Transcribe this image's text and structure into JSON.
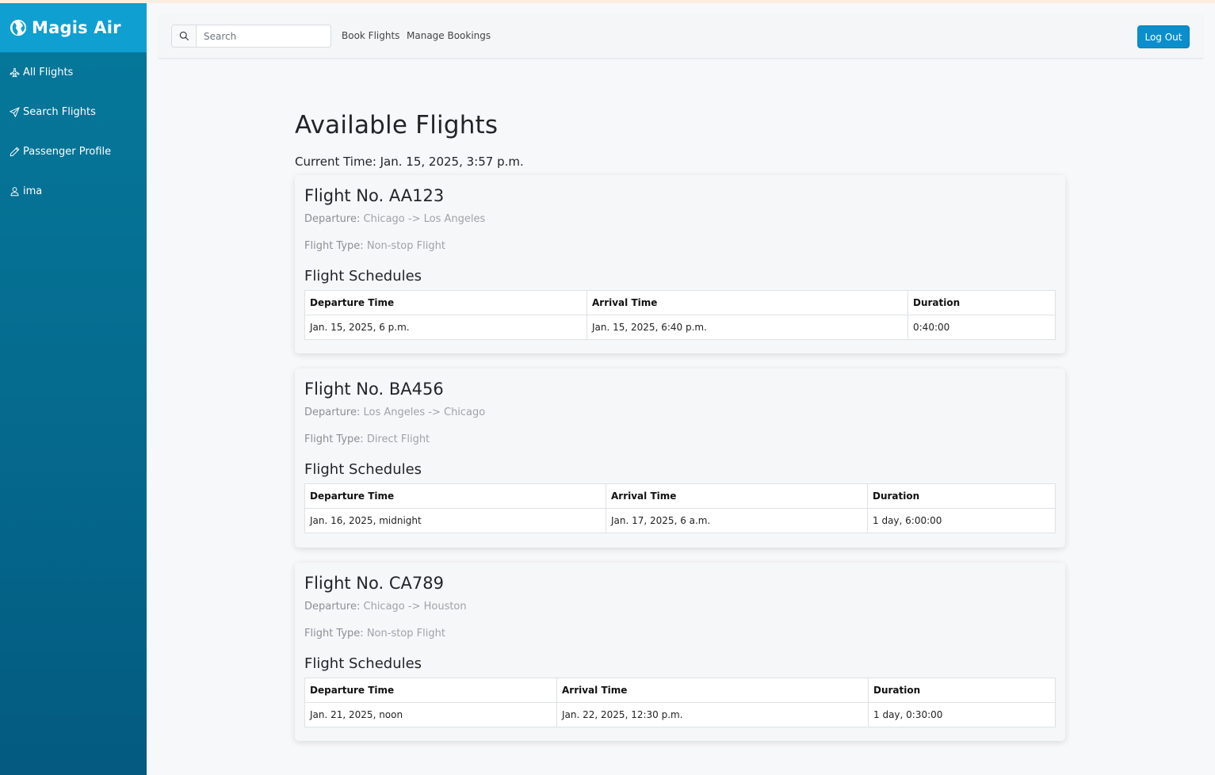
{
  "app": {
    "name": "Magis Air"
  },
  "sidebar": {
    "items": [
      {
        "label": "All Flights",
        "icon": "plane-icon"
      },
      {
        "label": "Search Flights",
        "icon": "send-icon"
      },
      {
        "label": "Passenger Profile",
        "icon": "pencil-icon"
      },
      {
        "label": "ima",
        "icon": "user-icon"
      }
    ]
  },
  "topbar": {
    "search_placeholder": "Search",
    "links": [
      "Book Flights",
      "Manage Bookings"
    ],
    "logout_label": "Log Out"
  },
  "main": {
    "heading": "Available Flights",
    "current_time": "Current Time: Jan. 15, 2025, 3:57 p.m.",
    "flights": [
      {
        "title": "Flight No. AA123",
        "departure_label": "Departure:",
        "departure_value": "Chicago -> Los Angeles",
        "type_label": "Flight Type:",
        "type_value": "Non-stop Flight",
        "schedules_title": "Flight Schedules",
        "columns": [
          "Departure Time",
          "Arrival Time",
          "Duration"
        ],
        "rows": [
          [
            "Jan. 15, 2025, 6 p.m.",
            "Jan. 15, 2025, 6:40 p.m.",
            "0:40:00"
          ]
        ]
      },
      {
        "title": "Flight No. BA456",
        "departure_label": "Departure:",
        "departure_value": "Los Angeles -> Chicago",
        "type_label": "Flight Type:",
        "type_value": "Direct Flight",
        "schedules_title": "Flight Schedules",
        "columns": [
          "Departure Time",
          "Arrival Time",
          "Duration"
        ],
        "rows": [
          [
            "Jan. 16, 2025, midnight",
            "Jan. 17, 2025, 6 a.m.",
            "1 day, 6:00:00"
          ]
        ]
      },
      {
        "title": "Flight No. CA789",
        "departure_label": "Departure:",
        "departure_value": "Chicago -> Houston",
        "type_label": "Flight Type:",
        "type_value": "Non-stop Flight",
        "schedules_title": "Flight Schedules",
        "columns": [
          "Departure Time",
          "Arrival Time",
          "Duration"
        ],
        "rows": [
          [
            "Jan. 21, 2025, noon",
            "Jan. 22, 2025, 12:30 p.m.",
            "1 day, 0:30:00"
          ]
        ]
      }
    ]
  },
  "colors": {
    "sidebar": "#05799b",
    "brand_bar": "#0f9fd1",
    "accent_button": "#0a8fcc"
  }
}
